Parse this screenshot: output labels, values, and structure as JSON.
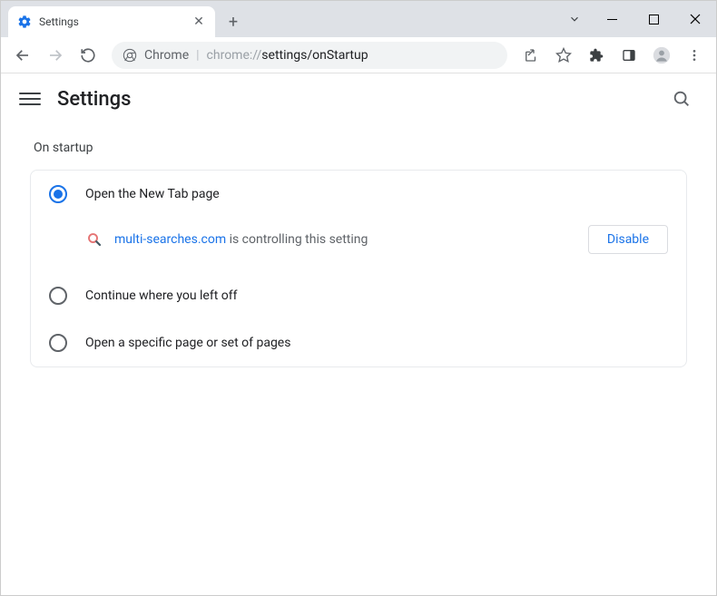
{
  "tab": {
    "title": "Settings"
  },
  "omnibox": {
    "scheme_label": "Chrome",
    "url_host": "chrome://",
    "url_path": "settings/onStartup"
  },
  "header": {
    "title": "Settings"
  },
  "section": {
    "title": "On startup"
  },
  "options": {
    "new_tab": "Open the New Tab page",
    "continue": "Continue where you left off",
    "specific": "Open a specific page or set of pages"
  },
  "controlling": {
    "extension": "multi-searches.com",
    "suffix": " is controlling this setting",
    "disable": "Disable"
  }
}
